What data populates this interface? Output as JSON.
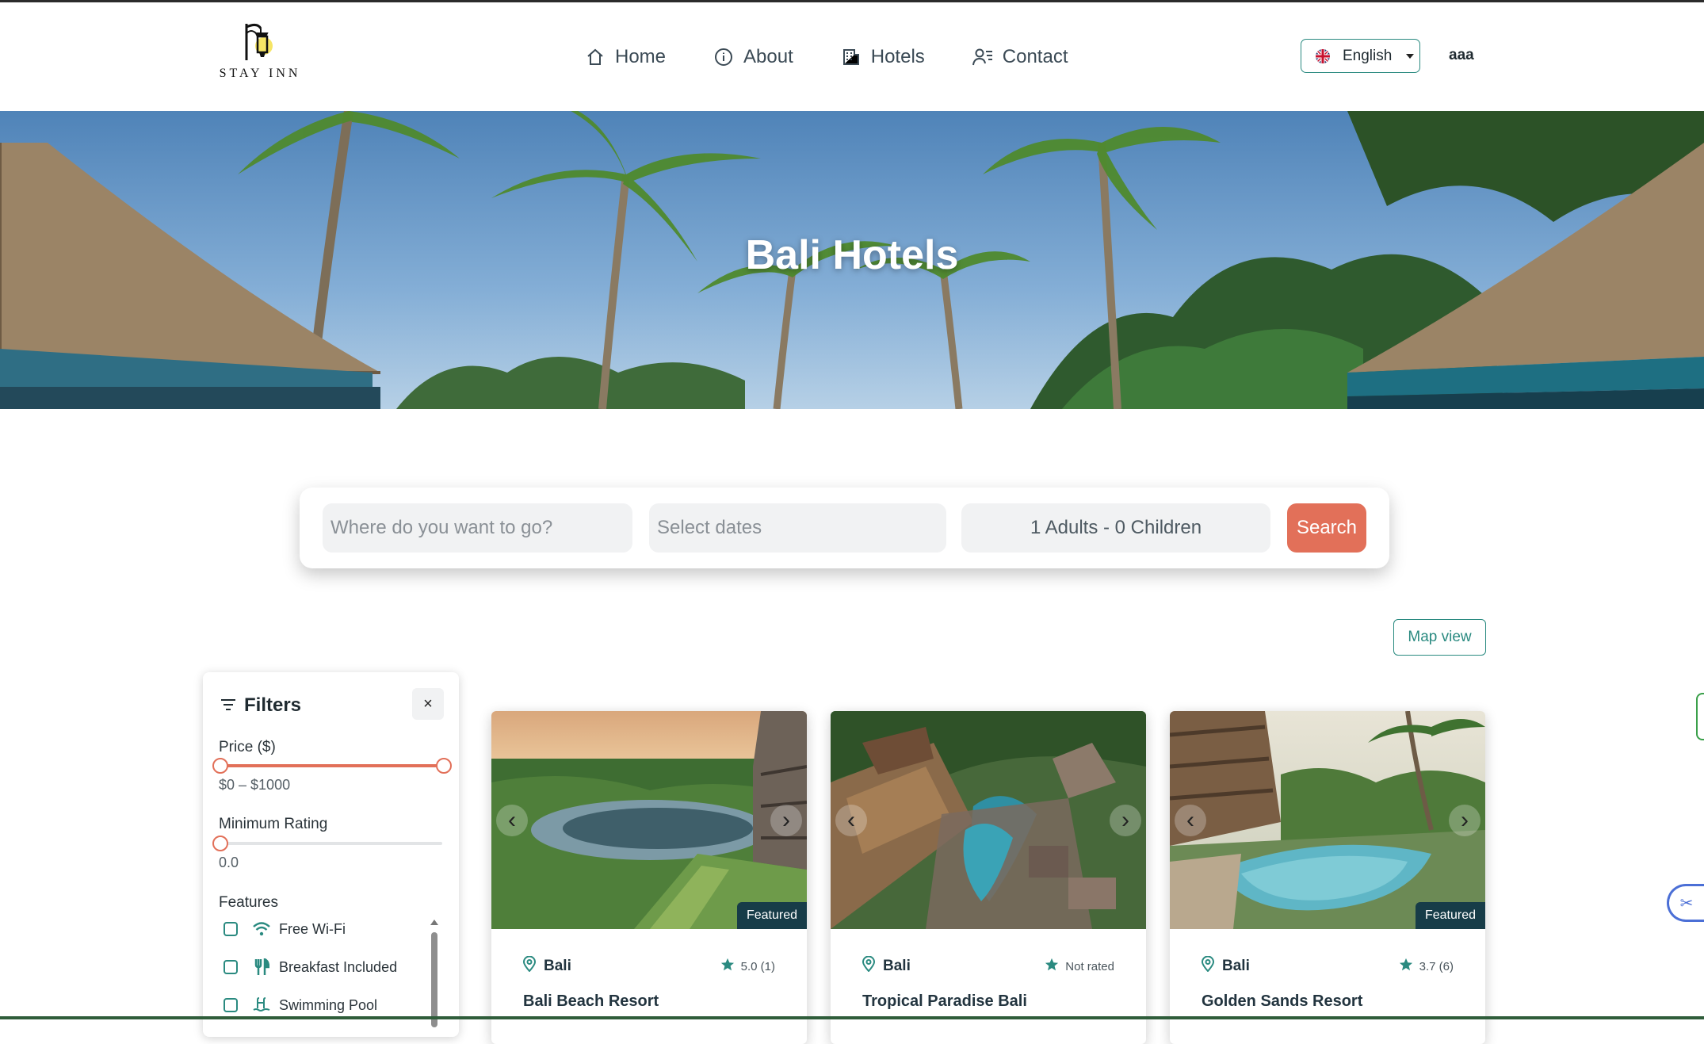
{
  "brand": {
    "logo_text": "STAY INN"
  },
  "nav": {
    "items": [
      {
        "label": "Home",
        "icon": "home-icon"
      },
      {
        "label": "About",
        "icon": "info-icon"
      },
      {
        "label": "Hotels",
        "icon": "building-icon"
      },
      {
        "label": "Contact",
        "icon": "contact-icon"
      }
    ]
  },
  "language": {
    "label": "English",
    "flag": "uk-flag-icon"
  },
  "user": {
    "name": "aaa"
  },
  "hero": {
    "title": "Bali Hotels"
  },
  "search": {
    "destination_placeholder": "Where do you want to go?",
    "dates_placeholder": "Select dates",
    "guests_value": "1 Adults - 0 Children",
    "button_label": "Search"
  },
  "map_view_label": "Map view",
  "filters": {
    "title": "Filters",
    "close_label": "×",
    "price_label": "Price ($)",
    "price_range_text": "$0 – $1000",
    "price_min": 0,
    "price_max": 1000,
    "rating_label": "Minimum Rating",
    "rating_value_text": "0.0",
    "rating_value": 0,
    "features_label": "Features",
    "features": [
      {
        "label": "Free Wi-Fi",
        "icon": "wifi-icon",
        "checked": false
      },
      {
        "label": "Breakfast Included",
        "icon": "utensils-icon",
        "checked": false
      },
      {
        "label": "Swimming Pool",
        "icon": "pool-icon",
        "checked": false
      }
    ]
  },
  "hotels": [
    {
      "location": "Bali",
      "rating_text": "5.0 (1)",
      "name": "Bali Beach Resort",
      "badge": "Featured"
    },
    {
      "location": "Bali",
      "rating_text": "Not rated",
      "name": "Tropical Paradise Bali",
      "badge": ""
    },
    {
      "location": "Bali",
      "rating_text": "3.7 (6)",
      "name": "Golden Sands Resort",
      "badge": "Featured"
    }
  ],
  "colors": {
    "accent_teal": "#2a8a80",
    "accent_coral": "#e27059",
    "badge_navy": "#173c48"
  }
}
